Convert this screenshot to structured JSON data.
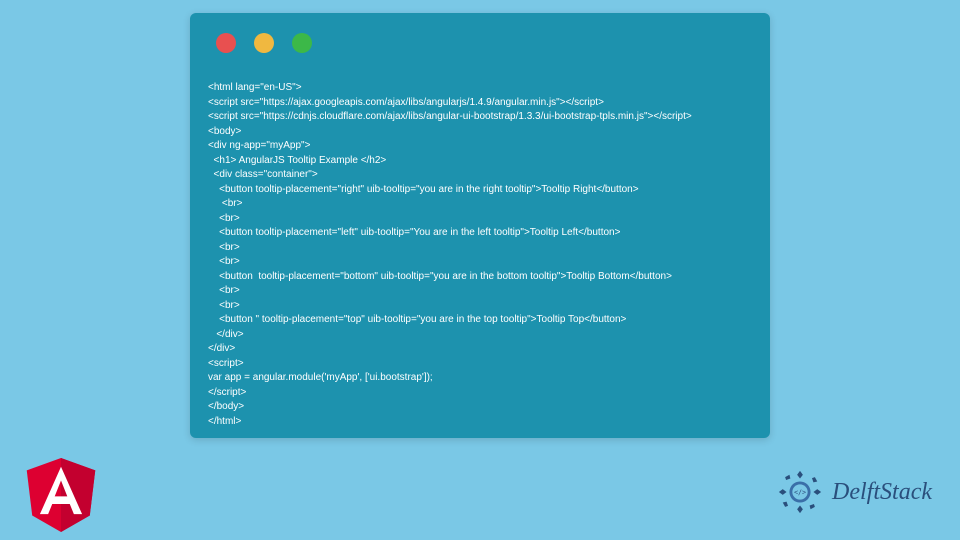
{
  "code_lines": [
    "<html lang=\"en-US\">",
    "<script src=\"https://ajax.googleapis.com/ajax/libs/angularjs/1.4.9/angular.min.js\"></script>",
    "<script src=\"https://cdnjs.cloudflare.com/ajax/libs/angular-ui-bootstrap/1.3.3/ui-bootstrap-tpls.min.js\"></script>",
    "<body>",
    "<div ng-app=\"myApp\">",
    "  <h1> AngularJS Tooltip Example </h2>",
    "  <div class=\"container\">",
    "    <button tooltip-placement=\"right\" uib-tooltip=\"you are in the right tooltip\">Tooltip Right</button>",
    "     <br>",
    "    <br>",
    "    <button tooltip-placement=\"left\" uib-tooltip=\"You are in the left tooltip\">Tooltip Left</button>",
    "    <br>",
    "    <br>",
    "    <button  tooltip-placement=\"bottom\" uib-tooltip=\"you are in the bottom tooltip\">Tooltip Bottom</button>",
    "    <br>",
    "    <br>",
    "    <button \" tooltip-placement=\"top\" uib-tooltip=\"you are in the top tooltip\">Tooltip Top</button>",
    "   </div>",
    "</div>",
    "<script>",
    "var app = angular.module('myApp', ['ui.bootstrap']);",
    "</script>",
    "</body>",
    "</html>"
  ],
  "brand_text": "DelftStack"
}
